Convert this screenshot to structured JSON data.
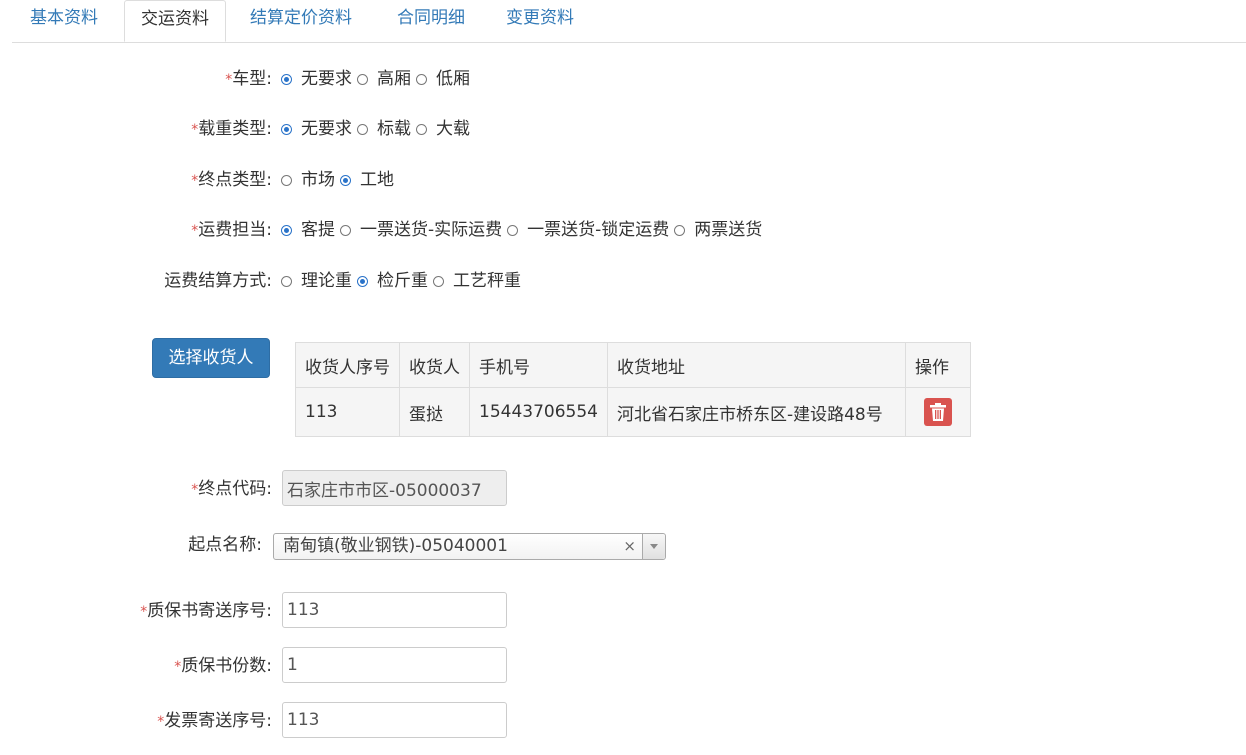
{
  "tabs": [
    {
      "label": "基本资料",
      "active": false
    },
    {
      "label": "交运资料",
      "active": true
    },
    {
      "label": "结算定价资料",
      "active": false
    },
    {
      "label": "合同明细",
      "active": false
    },
    {
      "label": "变更资料",
      "active": false
    }
  ],
  "form": {
    "vehicle_type": {
      "label": "车型:",
      "required": "*",
      "options": [
        "无要求",
        "高厢",
        "低厢"
      ],
      "selected": "无要求"
    },
    "load_type": {
      "label": "载重类型:",
      "required": "*",
      "options": [
        "无要求",
        "标载",
        "大载"
      ],
      "selected": "无要求"
    },
    "destination_type": {
      "label": "终点类型:",
      "required": "*",
      "options": [
        "市场",
        "工地"
      ],
      "selected": "工地"
    },
    "freight_bearer": {
      "label": "运费担当:",
      "required": "*",
      "options": [
        "客提",
        "一票送货-实际运费",
        "一票送货-锁定运费",
        "两票送货"
      ],
      "selected": "客提"
    },
    "freight_settlement": {
      "label": "运费结算方式:",
      "required": "",
      "options": [
        "理论重",
        "检斤重",
        "工艺秤重"
      ],
      "selected": "检斤重"
    }
  },
  "select_consignee_button": "选择收货人",
  "consignee_table": {
    "headers": [
      "收货人序号",
      "收货人",
      "手机号",
      "收货地址",
      "操作"
    ],
    "rows": [
      {
        "id": "113",
        "name": "蛋挞",
        "phone": "15443706554",
        "address": "河北省石家庄市桥东区-建设路48号"
      }
    ]
  },
  "destination_code": {
    "label": "终点代码:",
    "required": "*",
    "value": "石家庄市市区-05000037"
  },
  "origin_name": {
    "label": "起点名称:",
    "required": "",
    "value": "南甸镇(敬业钢铁)-05040001",
    "clear": "×"
  },
  "warranty_mail_no": {
    "label": "质保书寄送序号:",
    "required": "*",
    "value": "113"
  },
  "warranty_copies": {
    "label": "质保书份数:",
    "required": "*",
    "value": "1"
  },
  "invoice_mail_no": {
    "label": "发票寄送序号:",
    "required": "*",
    "value": "113"
  },
  "colors": {
    "primary": "#337ab7",
    "danger": "#d9534f",
    "required": "#d9534f",
    "radio_checked": "#2a73c9"
  }
}
